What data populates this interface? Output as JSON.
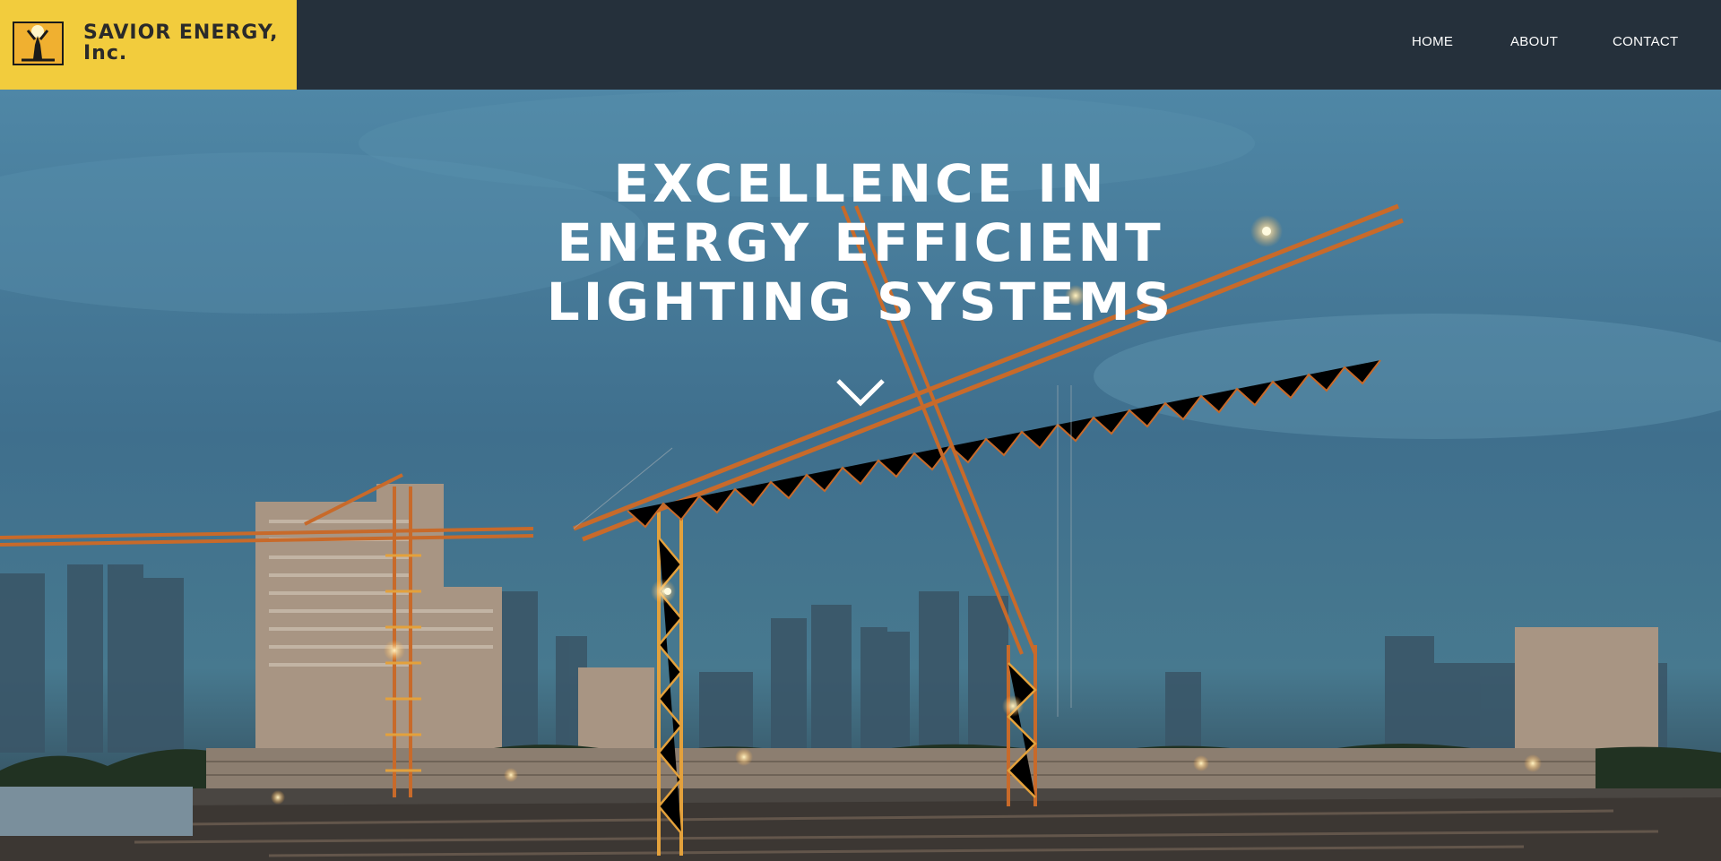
{
  "brand": {
    "name_line1": "SAVIOR ENERGY,",
    "name_line2": "Inc.",
    "logo_icon": "lightbulb-figure-icon",
    "logo_color": "#f2cc3d"
  },
  "nav": {
    "items": [
      {
        "label": "HOME"
      },
      {
        "label": "ABOUT"
      },
      {
        "label": "CONTACT"
      }
    ]
  },
  "hero": {
    "title_lines": [
      "EXCELLENCE IN",
      "ENERGY EFFICIENT",
      "LIGHTING SYSTEMS"
    ],
    "scroll_icon": "chevron-down-icon",
    "background": "construction-cranes-city-dusk"
  },
  "colors": {
    "header_bg": "#25303b",
    "accent": "#f2cc3d",
    "crane": "#c86a2a",
    "sky": "#4a7e9c"
  }
}
